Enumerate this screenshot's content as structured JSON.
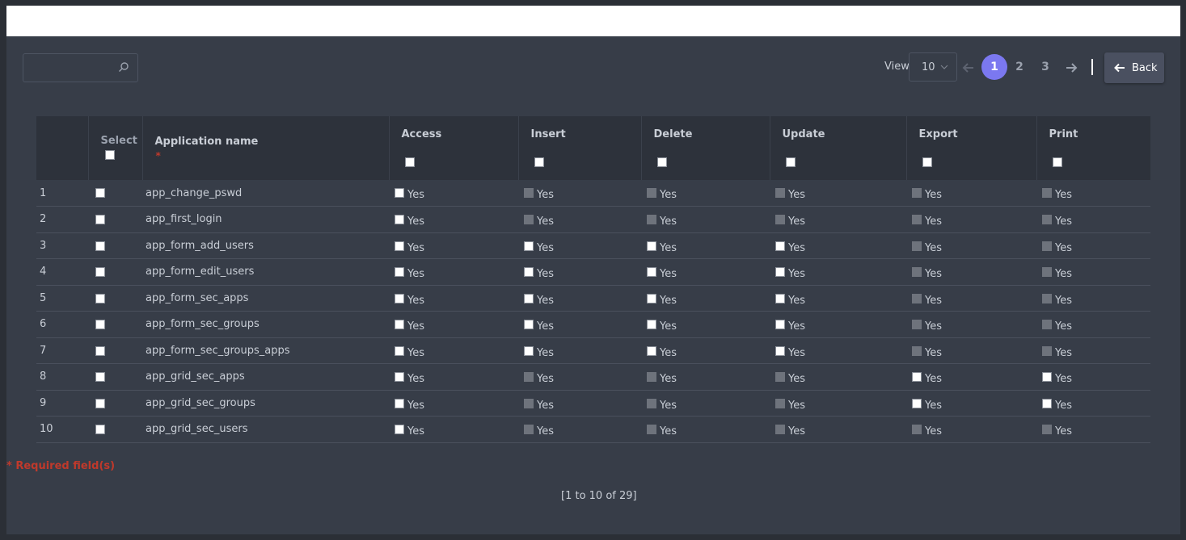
{
  "toolbar": {
    "search_placeholder": "",
    "view_label": "View",
    "view_value": "10",
    "pages": [
      "1",
      "2",
      "3"
    ],
    "current_page": "1",
    "back_label": "Back"
  },
  "table": {
    "headers": {
      "select": "Select",
      "app_name": "Application name",
      "required_mark": "*",
      "access": "Access",
      "insert": "Insert",
      "delete": "Delete",
      "update": "Update",
      "export": "Export",
      "print": "Print"
    },
    "yes_label": "Yes",
    "rows": [
      {
        "num": "1",
        "app": "app_change_pswd",
        "enabled": [
          true,
          false,
          false,
          false,
          false,
          false
        ]
      },
      {
        "num": "2",
        "app": "app_first_login",
        "enabled": [
          true,
          false,
          false,
          false,
          false,
          false
        ]
      },
      {
        "num": "3",
        "app": "app_form_add_users",
        "enabled": [
          true,
          true,
          true,
          true,
          false,
          false
        ]
      },
      {
        "num": "4",
        "app": "app_form_edit_users",
        "enabled": [
          true,
          true,
          true,
          true,
          false,
          false
        ]
      },
      {
        "num": "5",
        "app": "app_form_sec_apps",
        "enabled": [
          true,
          true,
          true,
          true,
          false,
          false
        ]
      },
      {
        "num": "6",
        "app": "app_form_sec_groups",
        "enabled": [
          true,
          true,
          true,
          true,
          false,
          false
        ]
      },
      {
        "num": "7",
        "app": "app_form_sec_groups_apps",
        "enabled": [
          true,
          true,
          true,
          true,
          false,
          false
        ]
      },
      {
        "num": "8",
        "app": "app_grid_sec_apps",
        "enabled": [
          true,
          false,
          false,
          false,
          true,
          true
        ]
      },
      {
        "num": "9",
        "app": "app_grid_sec_groups",
        "enabled": [
          true,
          false,
          false,
          false,
          true,
          true
        ]
      },
      {
        "num": "10",
        "app": "app_grid_sec_users",
        "enabled": [
          true,
          false,
          false,
          false,
          false,
          false
        ]
      }
    ]
  },
  "footer": {
    "required_note": "* Required field(s)",
    "summary": "[1 to 10 of 29]"
  }
}
